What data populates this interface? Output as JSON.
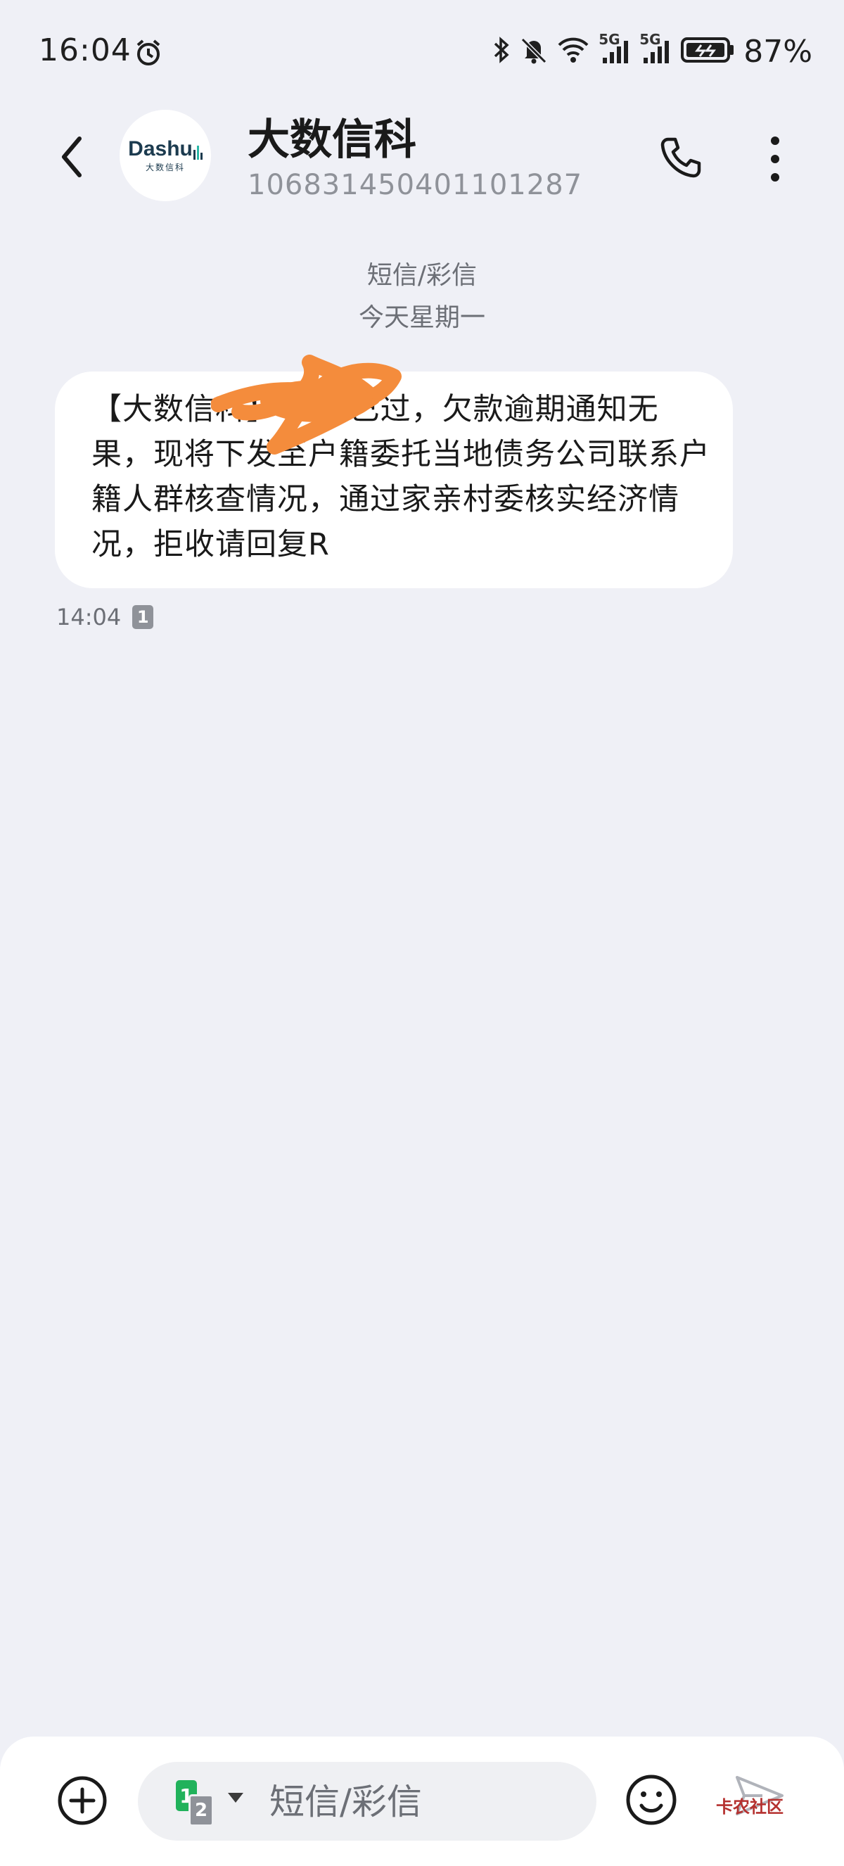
{
  "status_bar": {
    "time": "16:04",
    "network_1": "5G",
    "network_2": "5G",
    "battery_percent": "87%",
    "icons": [
      "alarm-icon",
      "bluetooth-icon",
      "mute-icon",
      "wifi-icon",
      "signal-icon",
      "battery-icon"
    ]
  },
  "header": {
    "avatar_brand": "Dashu",
    "avatar_brand_sub": "大数信科",
    "contact_name": "大数信科",
    "contact_number": "106831450401101287"
  },
  "divider": {
    "type_label": "短信/彩信",
    "date_label": "今天星期一"
  },
  "message": {
    "text": "【大数信科】      时间已过，欠款逾期通知无果，现将下发至户籍委托当地债务公司联系户籍人群核查情况，通过家亲村委核实经济情况，拒收请回复R",
    "time": "14:04",
    "sim": "1",
    "redaction_color": "#f48c3c"
  },
  "compose": {
    "sim_a": "1",
    "sim_b": "2",
    "placeholder": "短信/彩信",
    "value": "",
    "watermark": "卡农社区"
  },
  "colors": {
    "background": "#eff0f6",
    "bubble": "#ffffff",
    "sim_green": "#21b25b",
    "muted_text": "#6c6f76"
  }
}
